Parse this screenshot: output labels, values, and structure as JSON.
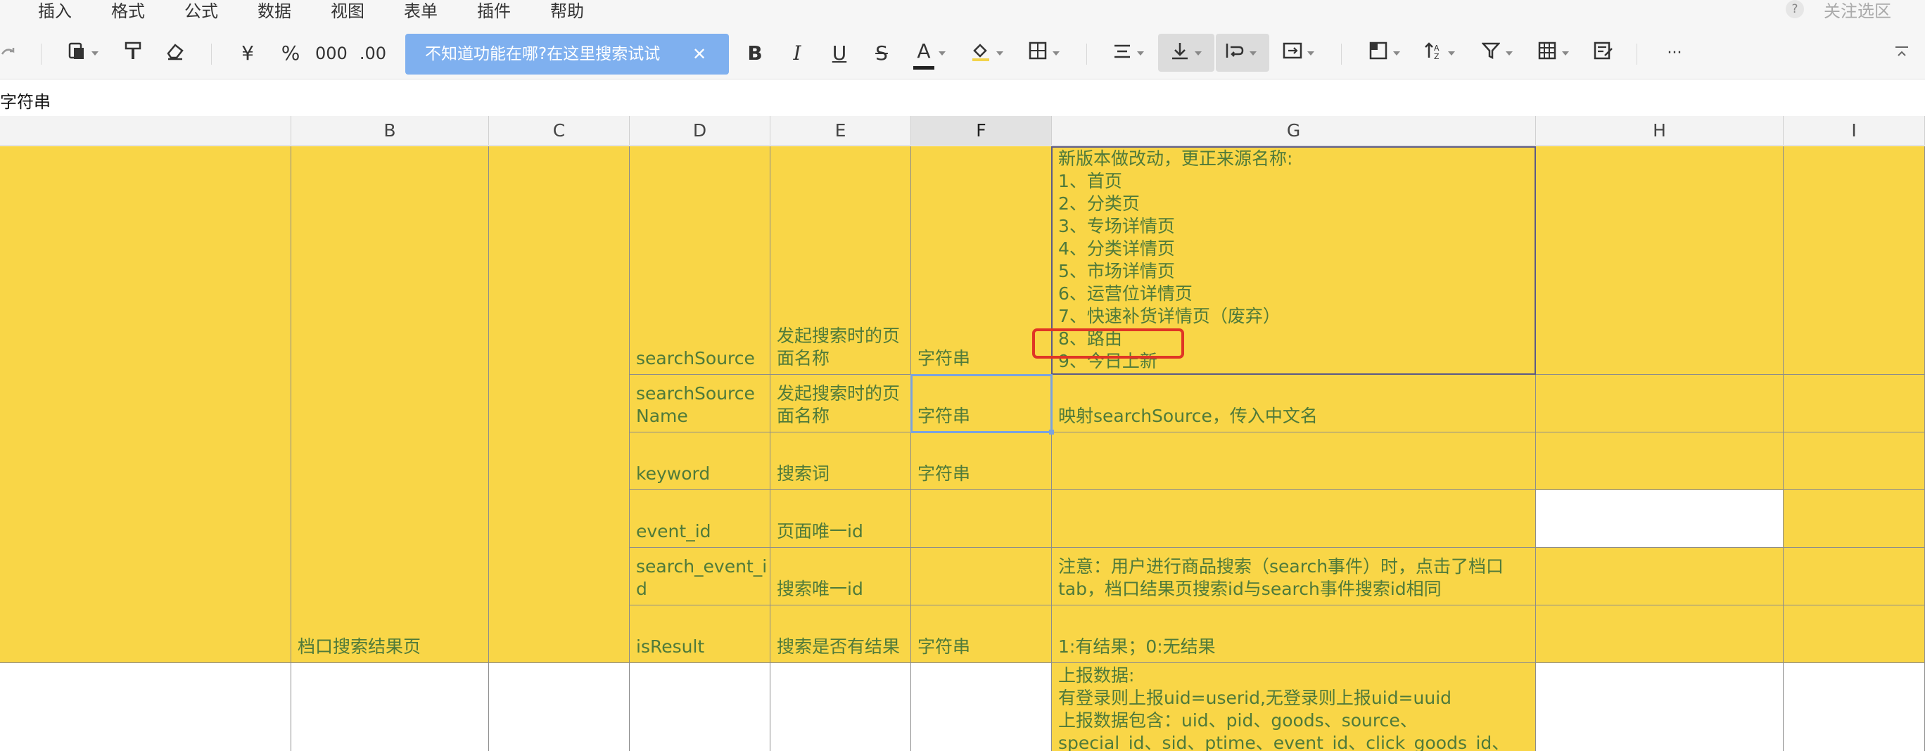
{
  "menu": {
    "items": [
      "插入",
      "格式",
      "公式",
      "数据",
      "视图",
      "表单",
      "插件",
      "帮助"
    ],
    "help_icon": "?",
    "focus_label": "关注选区"
  },
  "toolbar": {
    "currency": "¥",
    "percent": "%",
    "thousands": "000",
    "decimals": ".00",
    "bold": "B",
    "italic": "I",
    "underline": "U",
    "strike": "S",
    "font_color": "A",
    "more": "···",
    "tooltip_text": "不知道功能在哪?在这里搜索试试",
    "icons": [
      "redo-icon",
      "paste-icon",
      "format-painter-icon",
      "eraser-icon",
      "fill-color-icon",
      "border-icon",
      "align-icon",
      "valign-icon",
      "wrap-icon",
      "merge-icon",
      "freeze-icon",
      "sort-icon",
      "filter-icon",
      "table-icon",
      "form-icon",
      "collapse-icon"
    ]
  },
  "formula_bar": {
    "content": "字符串"
  },
  "columns": [
    "B",
    "C",
    "D",
    "E",
    "F",
    "G",
    "H",
    "I"
  ],
  "selected_column": "F",
  "rows": [
    {
      "B": "",
      "D": "searchSource",
      "E": "发起搜索时的页面名称",
      "F": "字符串",
      "G": "新版本做改动，更正来源名称:\n1、首页\n2、分类页\n3、专场详情页\n4、分类详情页\n5、市场详情页\n6、运营位详情页\n7、快速补货详情页（废弃）\n8、路由\n9、今日上新"
    },
    {
      "D": "searchSource\nName",
      "E": "发起搜索时的页面名称",
      "F": "字符串",
      "G": "映射searchSource，传入中文名"
    },
    {
      "D": "keyword",
      "E": "搜索词",
      "F": "字符串",
      "G": ""
    },
    {
      "D": "event_id",
      "E": "页面唯一id",
      "F": "",
      "G": ""
    },
    {
      "D": "search_event_i\nd",
      "E": "搜索唯一id",
      "F": "",
      "G": "注意：用户进行商品搜索（search事件）时，点击了档口tab，档口结果页搜索id与search事件搜索id相同"
    },
    {
      "B": "档口搜索结果页",
      "D": "isResult",
      "E": "搜索是否有结果",
      "F": "字符串",
      "G": "1:有结果；0:无结果"
    },
    {
      "G": "上报数据:\n有登录则上报uid=userid,无登录则上报uid=uuid\n上报数据包含：uid、pid、goods、source、\nspecial_id、sid、ptime、event_id、click_goods_id、"
    }
  ],
  "colors": {
    "cell_fill": "#f9d647",
    "cell_text": "#4f7a3a",
    "annotation": "#e03525",
    "selection": "#7ba3de"
  }
}
